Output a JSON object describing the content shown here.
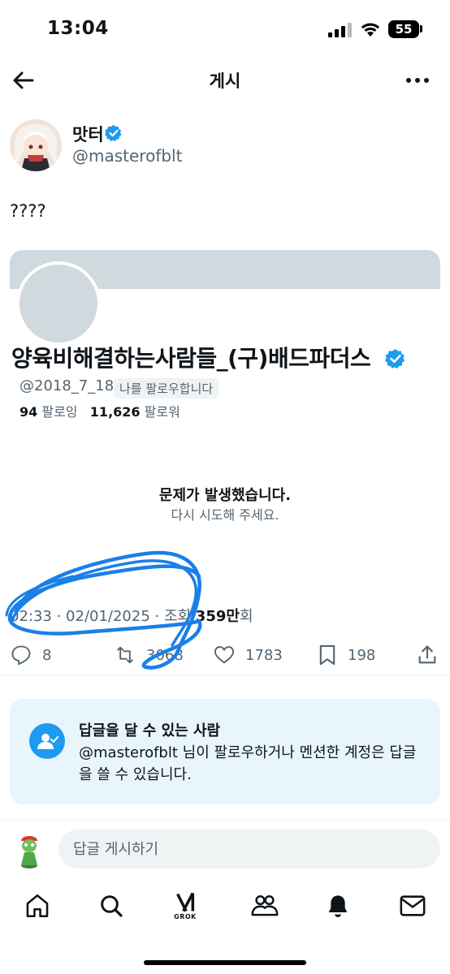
{
  "status_bar": {
    "time": "13:04",
    "battery": "55"
  },
  "header": {
    "title": "게시",
    "back_icon": "arrow-left-icon",
    "more_icon": "more-horizontal-icon"
  },
  "post": {
    "author_name": "맛터",
    "author_handle": "@masterofblt",
    "text": "????",
    "timestamp": "02:33 · 02/01/2025 · 조회 ",
    "views_number": "359만",
    "views_suffix": "회"
  },
  "quoted_profile": {
    "name": "양육비해결하는사람들_(구)배드파더스",
    "handle": "@2018_7_18",
    "follows_you": "나를 팔로우합니다",
    "following_count": "94",
    "following_label": "팔로잉",
    "followers_count": "11,626",
    "followers_label": "팔로워"
  },
  "error": {
    "title": "문제가 발생했습니다.",
    "subtitle": "다시 시도해 주세요."
  },
  "actions": {
    "reply_count": "8",
    "repost_count": "3068",
    "like_count": "1783",
    "bookmark_count": "198"
  },
  "reply_restriction": {
    "title": "답글을 달 수 있는 사람",
    "description": "@masterofblt 님이 팔로우하거나 멘션한 계정은 답글을 쓸 수 있습니다."
  },
  "compose": {
    "placeholder": "답글 게시하기"
  },
  "tab_bar": {
    "grok_label": "GROK"
  },
  "colors": {
    "accent": "#1d9bf0",
    "scribble": "#1a7fe8",
    "muted": "#536471"
  }
}
